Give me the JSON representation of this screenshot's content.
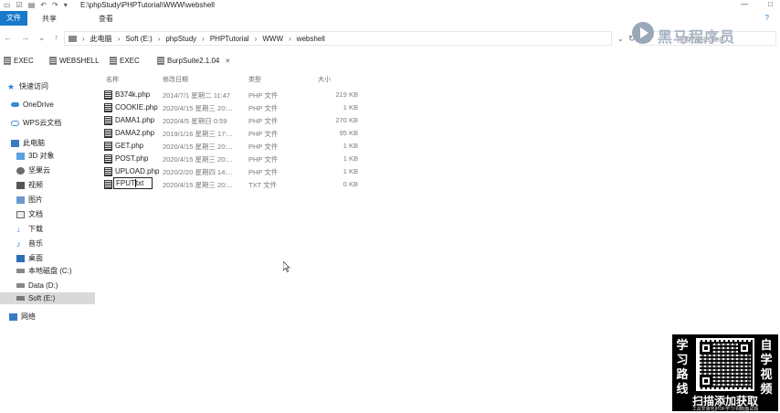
{
  "titlebar": {
    "path": "E:\\phpStudy\\PHPTutorial\\WWW\\webshell",
    "minimize": "—",
    "maximize": "□"
  },
  "ribbon": {
    "file": "文件",
    "share": "共享",
    "view": "查看"
  },
  "address": {
    "crumbs": [
      "此电脑",
      "Soft (E:)",
      "phpStudy",
      "PHPTutorial",
      "WWW",
      "webshell"
    ],
    "search_placeholder": "搜索\"webshell\""
  },
  "watermark": {
    "logo_text": "黑马程序员"
  },
  "tabs": [
    {
      "label": "EXEC"
    },
    {
      "label": "WEBSHELL"
    },
    {
      "label": "EXEC"
    },
    {
      "label": "BurpSuite2.1.04"
    }
  ],
  "nav": {
    "items": [
      {
        "label": "快速访问"
      },
      {
        "label": "OneDrive"
      },
      {
        "label": "WPS云文档"
      },
      {
        "label": "此电脑"
      },
      {
        "label": "3D 对象"
      },
      {
        "label": "坚果云"
      },
      {
        "label": "视频"
      },
      {
        "label": "图片"
      },
      {
        "label": "文档"
      },
      {
        "label": "下载"
      },
      {
        "label": "音乐"
      },
      {
        "label": "桌面"
      },
      {
        "label": "本地磁盘 (C:)"
      },
      {
        "label": "Data (D:)"
      },
      {
        "label": "Soft (E:)"
      },
      {
        "label": "网络"
      }
    ]
  },
  "columns": {
    "name": "名称",
    "date": "修改日期",
    "type": "类型",
    "size": "大小"
  },
  "files": [
    {
      "name": "B374k.php",
      "date": "2014/7/1 星期二 11:47",
      "type": "PHP 文件",
      "size": "219 KB"
    },
    {
      "name": "COOKIE.php",
      "date": "2020/4/15 星期三 20:...",
      "type": "PHP 文件",
      "size": "1 KB"
    },
    {
      "name": "DAMA1.php",
      "date": "2020/4/5 星期日 0:59",
      "type": "PHP 文件",
      "size": "270 KB"
    },
    {
      "name": "DAMA2.php",
      "date": "2019/1/16 星期三 17:...",
      "type": "PHP 文件",
      "size": "95 KB"
    },
    {
      "name": "GET.php",
      "date": "2020/4/15 星期三 20:...",
      "type": "PHP 文件",
      "size": "1 KB"
    },
    {
      "name": "POST.php",
      "date": "2020/4/15 星期三 20:...",
      "type": "PHP 文件",
      "size": "1 KB"
    },
    {
      "name": "UPLOAD.php",
      "date": "2020/2/20 星期四 14:...",
      "type": "PHP 文件",
      "size": "1 KB"
    },
    {
      "name": "",
      "date": "2020/4/15 星期三 20:...",
      "type": "TXT 文件",
      "size": "0 KB"
    }
  ],
  "rename": {
    "before_cursor": "FPUT",
    "after_cursor": "txt"
  },
  "promo": {
    "left_col": [
      "学",
      "习",
      "路",
      "线"
    ],
    "right_col": [
      "自",
      "学",
      "视",
      "频"
    ],
    "scan": "扫描添加获取",
    "footer": "工具安装包|PDF学习书籍|面试题"
  }
}
